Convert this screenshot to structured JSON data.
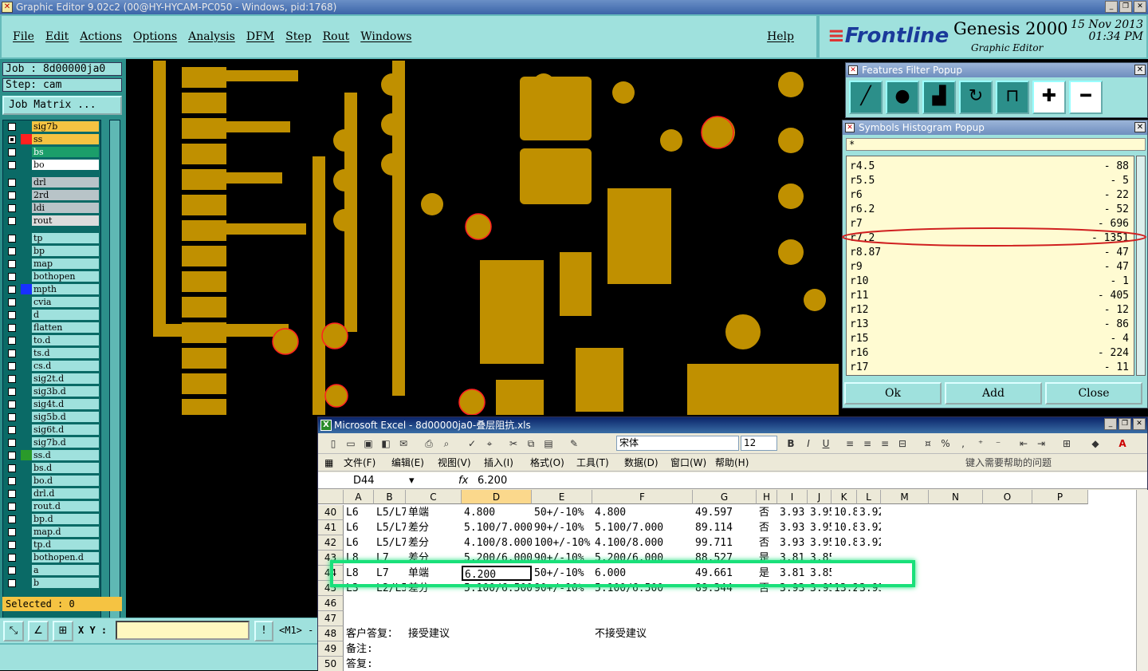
{
  "window": {
    "title": "Graphic Editor 9.02c2 (00@HY-HYCAM-PC050 - Windows, pid:1768)"
  },
  "menu": {
    "items": [
      "File",
      "Edit",
      "Actions",
      "Options",
      "Analysis",
      "DFM",
      "Step",
      "Rout",
      "Windows"
    ],
    "help": "Help"
  },
  "brand": {
    "logo": "Frontline",
    "product": "Genesis 2000",
    "subtitle": "Graphic Editor",
    "date": "15 Nov 2013",
    "time": "01:34 PM"
  },
  "left": {
    "job": "Job : 8d00000ja0",
    "step": "Step: cam",
    "job_matrix": "Job Matrix ...",
    "selected": "Selected : 0",
    "layers": [
      {
        "name": "sig7b",
        "color": "#f5c342",
        "checked": false
      },
      {
        "name": "ss",
        "color": "#f5c342",
        "checked": true,
        "swatch": "#ff2020"
      },
      {
        "name": "bs",
        "color": "#1b9e6a",
        "checked": false
      },
      {
        "name": "bo",
        "color": "#ffffff",
        "checked": false
      },
      {
        "name": "drl",
        "color": "#b8c4c8",
        "checked": false,
        "gap": true
      },
      {
        "name": "2rd",
        "color": "#b8c4c8",
        "checked": false
      },
      {
        "name": "ldi",
        "color": "#b8c4c8",
        "checked": false
      },
      {
        "name": "rout",
        "color": "#dcdcdc",
        "checked": false
      },
      {
        "name": "tp",
        "color": "#9fe1dd",
        "checked": false,
        "gap": true
      },
      {
        "name": "bp",
        "color": "#9fe1dd",
        "checked": false
      },
      {
        "name": "map",
        "color": "#9fe1dd",
        "checked": false
      },
      {
        "name": "bothopen",
        "color": "#9fe1dd",
        "checked": false
      },
      {
        "name": "mpth",
        "color": "#9fe1dd",
        "checked": false,
        "swatch": "#1830ff"
      },
      {
        "name": "cvia",
        "color": "#9fe1dd",
        "checked": false
      },
      {
        "name": "d",
        "color": "#9fe1dd",
        "checked": false
      },
      {
        "name": "flatten",
        "color": "#9fe1dd",
        "checked": false
      },
      {
        "name": "to.d",
        "color": "#9fe1dd",
        "checked": false
      },
      {
        "name": "ts.d",
        "color": "#9fe1dd",
        "checked": false
      },
      {
        "name": "cs.d",
        "color": "#9fe1dd",
        "checked": false
      },
      {
        "name": "sig2t.d",
        "color": "#9fe1dd",
        "checked": false
      },
      {
        "name": "sig3b.d",
        "color": "#9fe1dd",
        "checked": false
      },
      {
        "name": "sig4t.d",
        "color": "#9fe1dd",
        "checked": false
      },
      {
        "name": "sig5b.d",
        "color": "#9fe1dd",
        "checked": false
      },
      {
        "name": "sig6t.d",
        "color": "#9fe1dd",
        "checked": false
      },
      {
        "name": "sig7b.d",
        "color": "#9fe1dd",
        "checked": false
      },
      {
        "name": "ss.d",
        "color": "#9fe1dd",
        "checked": false,
        "swatch": "#2a9a2a"
      },
      {
        "name": "bs.d",
        "color": "#9fe1dd",
        "checked": false
      },
      {
        "name": "bo.d",
        "color": "#9fe1dd",
        "checked": false
      },
      {
        "name": "drl.d",
        "color": "#9fe1dd",
        "checked": false
      },
      {
        "name": "rout.d",
        "color": "#9fe1dd",
        "checked": false
      },
      {
        "name": "bp.d",
        "color": "#9fe1dd",
        "checked": false
      },
      {
        "name": "map.d",
        "color": "#9fe1dd",
        "checked": false
      },
      {
        "name": "tp.d",
        "color": "#9fe1dd",
        "checked": false
      },
      {
        "name": "bothopen.d",
        "color": "#9fe1dd",
        "checked": false
      },
      {
        "name": "a",
        "color": "#9fe1dd",
        "checked": false
      },
      {
        "name": "b",
        "color": "#9fe1dd",
        "checked": false
      }
    ]
  },
  "status": {
    "xy_label": "X Y :",
    "xy_value": "",
    "mode": "<M1> -"
  },
  "features_filter": {
    "title": "Features Filter Popup"
  },
  "histogram": {
    "title": "Symbols Histogram Popup",
    "filter": "*",
    "rows": [
      {
        "sym": "r4.5",
        "count": "- 88"
      },
      {
        "sym": "r5.5",
        "count": "- 5"
      },
      {
        "sym": "r6",
        "count": "- 22"
      },
      {
        "sym": "r6.2",
        "count": "- 52"
      },
      {
        "sym": "r7",
        "count": "- 696"
      },
      {
        "sym": "r7.2",
        "count": "- 1351"
      },
      {
        "sym": "r8.87",
        "count": "- 47"
      },
      {
        "sym": "r9",
        "count": "- 47"
      },
      {
        "sym": "r10",
        "count": "- 1"
      },
      {
        "sym": "r11",
        "count": "- 405"
      },
      {
        "sym": "r12",
        "count": "- 12"
      },
      {
        "sym": "r13",
        "count": "- 86"
      },
      {
        "sym": "r15",
        "count": "- 4"
      },
      {
        "sym": "r16",
        "count": "- 224"
      },
      {
        "sym": "r17",
        "count": "- 11"
      }
    ],
    "buttons": [
      "Ok",
      "Add",
      "Close"
    ]
  },
  "excel": {
    "title": "Microsoft Excel - 8d00000ja0-叠层阻抗.xls",
    "font": "宋体",
    "font_size": "12",
    "menus": [
      "文件(F)",
      "编辑(E)",
      "视图(V)",
      "插入(I)",
      "格式(O)",
      "工具(T)",
      "数据(D)",
      "窗口(W)",
      "帮助(H)"
    ],
    "help_placeholder": "键入需要帮助的问题",
    "name_box": "D44",
    "fx": "fx",
    "formula": "6.200",
    "columns": [
      "A",
      "B",
      "C",
      "D",
      "E",
      "F",
      "G",
      "H",
      "I",
      "J",
      "K",
      "L",
      "M",
      "N",
      "O",
      "P"
    ],
    "rows": [
      {
        "n": "40",
        "cells": [
          "L6",
          "L5/L7",
          "单端",
          "4.800",
          "50+/-10%",
          "4.800",
          "49.597",
          "否",
          "3.93",
          "3.95",
          "10.8",
          "3.92"
        ]
      },
      {
        "n": "41",
        "cells": [
          "L6",
          "L5/L7",
          "差分",
          "5.100/7.000",
          "90+/-10%",
          "5.100/7.000",
          "89.114",
          "否",
          "3.93",
          "3.95",
          "10.8",
          "3.92"
        ]
      },
      {
        "n": "42",
        "cells": [
          "L6",
          "L5/L7",
          "差分",
          "4.100/8.000",
          "100+/-10%",
          "4.100/8.000",
          "99.711",
          "否",
          "3.93",
          "3.95",
          "10.8",
          "3.92"
        ]
      },
      {
        "n": "43",
        "cells": [
          "L8",
          "L7",
          "差分",
          "5.200/6.000",
          "90+/-10%",
          "5.200/6.000",
          "88.527",
          "是",
          "3.81",
          "3.85",
          "",
          ""
        ]
      },
      {
        "n": "44",
        "cells": [
          "L8",
          "L7",
          "单端",
          "6.200",
          "50+/-10%",
          "6.000",
          "49.661",
          "是",
          "3.81",
          "3.85",
          "",
          ""
        ]
      },
      {
        "n": "45",
        "cells": [
          "L3",
          "L2/L5",
          "差分",
          "5.100/6.500",
          "90+/-10%",
          "5.100/6.500",
          "89.344",
          "否",
          "3.93",
          "3.95",
          "13.2",
          "3.93"
        ]
      },
      {
        "n": "46",
        "cells": [
          "",
          "",
          "",
          "",
          "",
          "",
          "",
          "",
          "",
          "",
          "",
          ""
        ]
      },
      {
        "n": "47",
        "cells": [
          "",
          "",
          "",
          "",
          "",
          "",
          "",
          "",
          "",
          "",
          "",
          ""
        ]
      },
      {
        "n": "48",
        "cells": [
          "客户答复：",
          "",
          "接受建议",
          "",
          "",
          "不接受建议",
          "",
          "",
          "",
          "",
          "",
          ""
        ]
      },
      {
        "n": "49",
        "cells": [
          "备注:",
          "",
          "",
          "",
          "",
          "",
          "",
          "",
          "",
          "",
          "",
          ""
        ]
      },
      {
        "n": "50",
        "cells": [
          "答复:",
          "",
          "",
          "",
          "",
          "",
          "",
          "",
          "",
          "",
          "",
          ""
        ]
      }
    ]
  }
}
